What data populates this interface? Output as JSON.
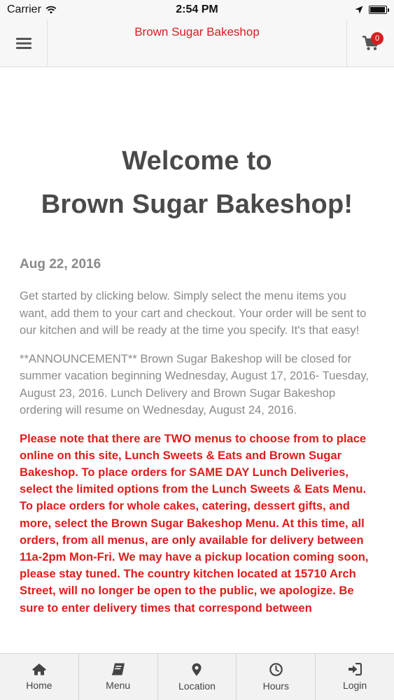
{
  "status_bar": {
    "carrier": "Carrier",
    "time": "2:54 PM",
    "battery_level": 0.95
  },
  "header": {
    "title": "Brown Sugar Bakeshop",
    "cart_count": "0",
    "menu_icon": "hamburger-icon",
    "cart_icon": "cart-icon"
  },
  "content": {
    "welcome_line1": "Welcome to",
    "welcome_line2": "Brown Sugar Bakeshop!",
    "date": "Aug 22, 2016",
    "intro": "Get started by clicking below. Simply select the menu items you want, add them to your cart and checkout. Your order will be sent to our kitchen and will be ready at the time you specify. It's that easy!",
    "announcement": "**ANNOUNCEMENT** Brown Sugar Bakeshop will be closed for summer vacation beginning Wednesday, August 17, 2016- Tuesday, August 23, 2016. Lunch Delivery and Brown Sugar Bakeshop ordering will resume on Wednesday, August 24, 2016.",
    "notice": "Please note that there are TWO menus to choose from to place online on this site, Lunch Sweets & Eats and Brown Sugar Bakeshop. To place orders for SAME DAY Lunch Deliveries, select the limited options from the Lunch Sweets & Eats Menu. To place orders for whole cakes, catering, dessert gifts, and more, select the Brown Sugar Bakeshop Menu. At this time, all orders, from all menus, are only available for delivery between 11a-2pm Mon-Fri. We may have a pickup location coming soon, please stay tuned. The country kitchen located at 15710 Arch Street, will no longer be open to the public, we apologize. Be sure to enter delivery times that correspond between"
  },
  "tabs": [
    {
      "label": "Home",
      "icon": "home-icon"
    },
    {
      "label": "Menu",
      "icon": "book-icon"
    },
    {
      "label": "Location",
      "icon": "map-marker-icon"
    },
    {
      "label": "Hours",
      "icon": "clock-icon"
    },
    {
      "label": "Login",
      "icon": "login-icon"
    }
  ],
  "colors": {
    "brand_red": "#d32020",
    "notice_red": "#e01b1b",
    "heading_gray": "#4a4a4a",
    "text_gray": "#8a8a8a"
  }
}
